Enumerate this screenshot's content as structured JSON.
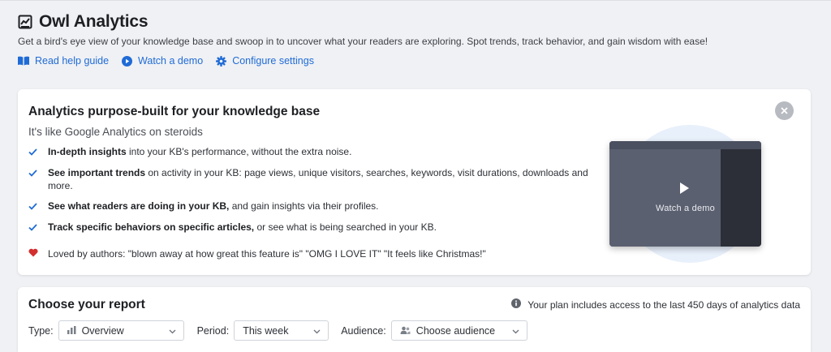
{
  "header": {
    "title": "Owl Analytics",
    "subtitle": "Get a bird's eye view of your knowledge base and swoop in to uncover what your readers are exploring. Spot trends, track behavior, and gain wisdom with ease!",
    "links": [
      {
        "label": "Read help guide",
        "icon": "book-icon"
      },
      {
        "label": "Watch a demo",
        "icon": "play-circle-icon"
      },
      {
        "label": "Configure settings",
        "icon": "gear-icon"
      }
    ]
  },
  "promo": {
    "heading": "Analytics purpose-built for your knowledge base",
    "tagline": "It's like Google Analytics on steroids",
    "bullets": [
      {
        "bold": "In-depth insights",
        "rest": " into your KB's performance, without the extra noise."
      },
      {
        "bold": "See important trends",
        "rest": " on activity in your KB: page views, unique visitors, searches, keywords, visit durations, downloads and more."
      },
      {
        "bold": "See what readers are doing in your KB,",
        "rest": " and gain insights via their profiles."
      },
      {
        "bold": "Track specific behaviors on specific articles,",
        "rest": " or see what is being searched in your KB."
      }
    ],
    "loved": "Loved by authors: \"blown away at how great this feature is\" \"OMG I LOVE IT\" \"It feels like Christmas!\"",
    "video_label": "Watch a demo"
  },
  "report": {
    "heading": "Choose your report",
    "plan_note": "Your plan includes access to the last 450 days of analytics data",
    "type_label": "Type:",
    "type_value": "Overview",
    "period_label": "Period:",
    "period_value": "This week",
    "audience_label": "Audience:",
    "audience_value": "Choose audience"
  },
  "colors": {
    "accent": "#1f6bd6",
    "check": "#1f6bd6",
    "heart": "#d32f2f",
    "background": "#f0f1f4"
  }
}
